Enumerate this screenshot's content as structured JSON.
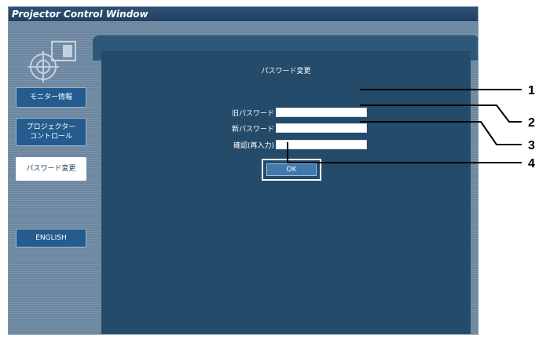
{
  "window": {
    "title": "Projector Control Window"
  },
  "sidebar": {
    "logo_icon": "projector-logo-icon",
    "items": [
      {
        "label": "モニター情報"
      },
      {
        "label": "プロジェクター\nコントロール"
      },
      {
        "label": "パスワード変更"
      },
      {
        "label": "ENGLISH"
      }
    ]
  },
  "main": {
    "heading": "パスワード変更",
    "fields": [
      {
        "label": "旧パスワード",
        "value": "",
        "placeholder": ""
      },
      {
        "label": "新パスワード",
        "value": "",
        "placeholder": ""
      },
      {
        "label": "確認(再入力)",
        "value": "",
        "placeholder": ""
      }
    ],
    "ok_label": "OK"
  },
  "callouts": [
    "1",
    "2",
    "3",
    "4"
  ],
  "colors": {
    "panel": "#244b6a",
    "sidebar_button": "#245c8f",
    "ok_button": "#3f79ae"
  }
}
